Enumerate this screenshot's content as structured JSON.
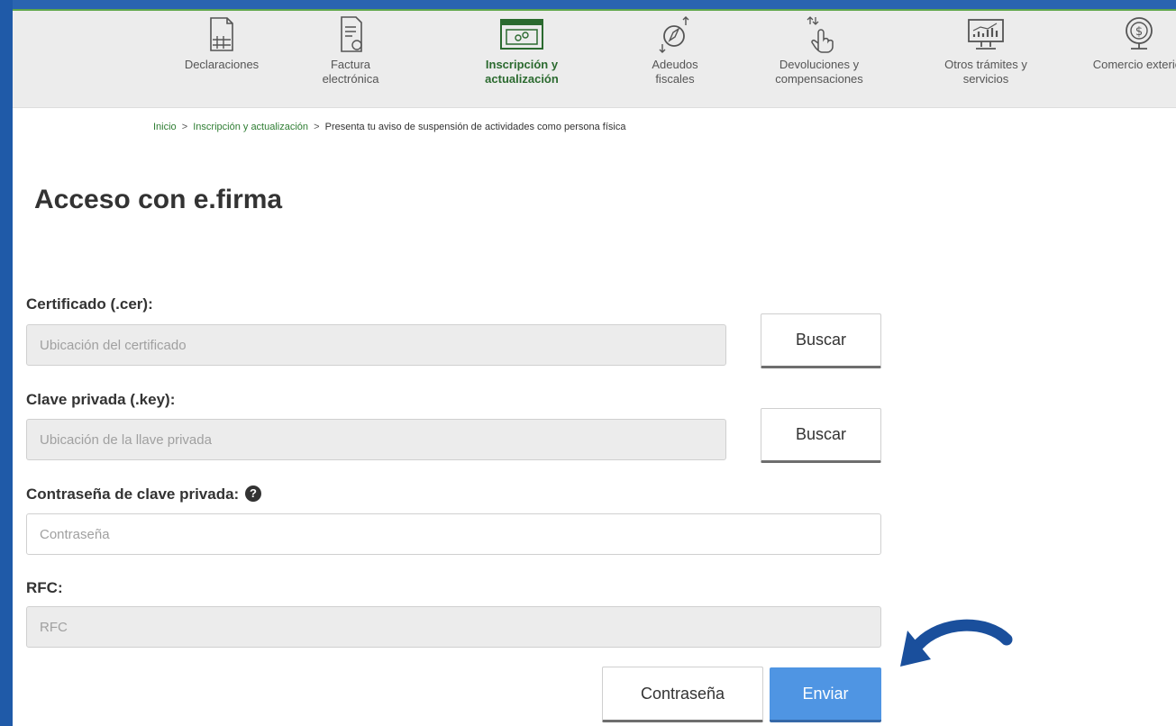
{
  "nav": {
    "items": [
      {
        "label": "Declaraciones",
        "icon": "document-grid-icon",
        "active": false
      },
      {
        "label": "Factura electrónica",
        "icon": "invoice-icon",
        "active": false
      },
      {
        "label": "Inscripción y actualización",
        "icon": "browser-gear-icon",
        "active": true
      },
      {
        "label": "Adeudos fiscales",
        "icon": "compass-arrows-icon",
        "active": false
      },
      {
        "label": "Devoluciones y compensaciones",
        "icon": "hand-pointer-icon",
        "active": false
      },
      {
        "label": "Otros trámites y servicios",
        "icon": "chart-monitor-icon",
        "active": false
      },
      {
        "label": "Comercio exterior",
        "icon": "globe-money-icon",
        "active": false
      }
    ]
  },
  "breadcrumb": {
    "home": "Inicio",
    "section": "Inscripción y actualización",
    "current": "Presenta tu aviso de suspensión de actividades como persona física",
    "separator": ">"
  },
  "page": {
    "title": "Acceso con e.firma"
  },
  "form": {
    "certificate": {
      "label": "Certificado (.cer):",
      "placeholder": "Ubicación del certificado",
      "button": "Buscar"
    },
    "private_key": {
      "label": "Clave privada (.key):",
      "placeholder": "Ubicación de la llave privada",
      "button": "Buscar"
    },
    "password": {
      "label": "Contraseña de clave privada:",
      "placeholder": "Contraseña",
      "help_icon": "question-circle-icon"
    },
    "rfc": {
      "label": "RFC:",
      "placeholder": "RFC"
    },
    "buttons": {
      "password": "Contraseña",
      "submit": "Enviar"
    }
  },
  "colors": {
    "accent_blue": "#4f95e3",
    "nav_active_green": "#2b6a2f",
    "frame_blue": "#1f5aa8"
  }
}
